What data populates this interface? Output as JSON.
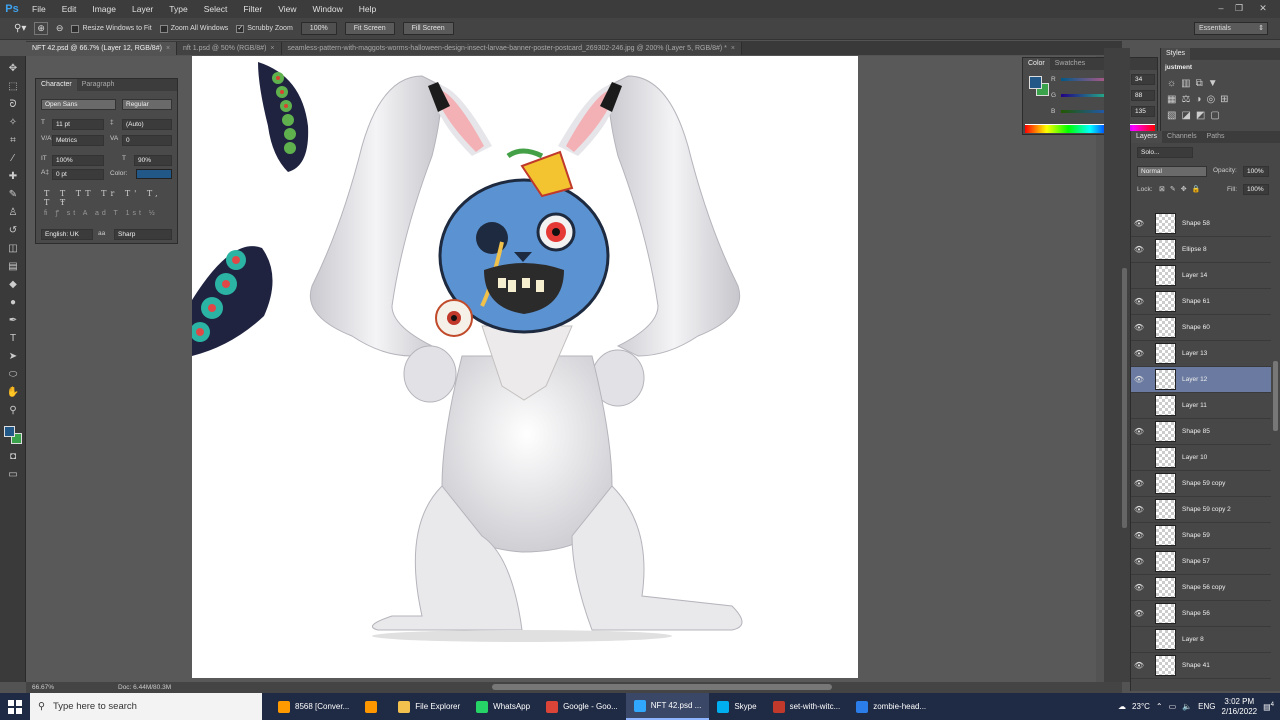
{
  "app": {
    "logo": "Ps"
  },
  "menu": [
    "File",
    "Edit",
    "Image",
    "Layer",
    "Type",
    "Select",
    "Filter",
    "View",
    "Window",
    "Help"
  ],
  "window_controls": {
    "minimize": "–",
    "restore": "❐",
    "close": "✕"
  },
  "options": {
    "resize_windows": "Resize Windows to Fit",
    "zoom_all": "Zoom All Windows",
    "scrubby_zoom": "Scrubby Zoom",
    "btn_100": "100%",
    "btn_fit": "Fit Screen",
    "btn_fill": "Fill Screen",
    "workspace": "Essentials"
  },
  "tabs": [
    {
      "label": "NFT 42.psd @ 66.7% (Layer 12, RGB/8#)",
      "active": true
    },
    {
      "label": "nft 1.psd @ 50% (RGB/8#)",
      "active": false
    },
    {
      "label": "seamless-pattern-with-maggots-worms-halloween-design-insect-larvae-banner-poster-postcard_269302-246.jpg @ 200% (Layer 5, RGB/8#) *",
      "active": false
    }
  ],
  "character": {
    "tabs": [
      "Character",
      "Paragraph"
    ],
    "font_family": "Open Sans",
    "font_style": "Regular",
    "font_size": "11 pt",
    "leading": "(Auto)",
    "kerning": "Metrics",
    "tracking": "0",
    "vscale": "100%",
    "hscale": "90%",
    "baseline": "0 pt",
    "color_label": "Color:",
    "language": "English: UK",
    "aa_label": "aa",
    "antialias": "Sharp",
    "type_buttons": [
      "T",
      "T",
      "TT",
      "Tr",
      "T'",
      "T,",
      "T",
      "T"
    ],
    "extra_buttons": [
      "fi",
      "ꝭ",
      "st",
      "A",
      "aa",
      "T",
      "1st",
      "½"
    ]
  },
  "color_panel": {
    "tabs": [
      "Color",
      "Swatches"
    ],
    "r": "34",
    "g": "88",
    "b": "135",
    "r_label": "R",
    "g_label": "G",
    "b_label": "B",
    "fg": "#225887",
    "bg": "#3aa24a"
  },
  "styles_panel": {
    "tab": "Styles",
    "title": "justment"
  },
  "layers_panel": {
    "tabs": [
      "Layers",
      "Channels",
      "Paths"
    ],
    "filter": "Solo...",
    "blend_mode": "Normal",
    "opacity_label": "Opacity:",
    "opacity": "100%",
    "lock_label": "Lock:",
    "fill_label": "Fill:",
    "fill": "100%",
    "layers": [
      {
        "name": "Shape 58",
        "visible": true
      },
      {
        "name": "Ellipse 8",
        "visible": true
      },
      {
        "name": "Layer 14",
        "visible": false
      },
      {
        "name": "Shape 61",
        "visible": true
      },
      {
        "name": "Shape 60",
        "visible": true
      },
      {
        "name": "Layer 13",
        "visible": true
      },
      {
        "name": "Layer 12",
        "visible": true,
        "selected": true
      },
      {
        "name": "Layer 11",
        "visible": false
      },
      {
        "name": "Shape 85",
        "visible": true
      },
      {
        "name": "Layer 10",
        "visible": false
      },
      {
        "name": "Shape 59 copy",
        "visible": true
      },
      {
        "name": "Shape 59 copy 2",
        "visible": true
      },
      {
        "name": "Shape 59",
        "visible": true
      },
      {
        "name": "Shape 57",
        "visible": true
      },
      {
        "name": "Shape 56 copy",
        "visible": true
      },
      {
        "name": "Shape 56",
        "visible": true
      },
      {
        "name": "Layer 8",
        "visible": false
      },
      {
        "name": "Shape 41",
        "visible": true
      }
    ]
  },
  "status": {
    "zoom": "66.67%",
    "doc": "Doc: 6.44M/80.3M"
  },
  "taskbar": {
    "search_placeholder": "Type here to search",
    "items": [
      {
        "label": "8568 [Conver...",
        "color": "#ff9a00"
      },
      {
        "label": "",
        "color": "#ff9800"
      },
      {
        "label": "File Explorer",
        "color": "#f2c14e"
      },
      {
        "label": "WhatsApp",
        "color": "#25d366"
      },
      {
        "label": "Google - Goo...",
        "color": "#db4437"
      },
      {
        "label": "NFT 42.psd ...",
        "color": "#31a8ff",
        "active": true
      },
      {
        "label": "Skype",
        "color": "#00aff0"
      },
      {
        "label": "set-with-witc...",
        "color": "#c0392b"
      },
      {
        "label": "zombie-head...",
        "color": "#2b7de9"
      }
    ],
    "temperature": "23°C",
    "language": "ENG",
    "time": "3:02 PM",
    "date": "2/16/2022",
    "notification_count": "4"
  }
}
